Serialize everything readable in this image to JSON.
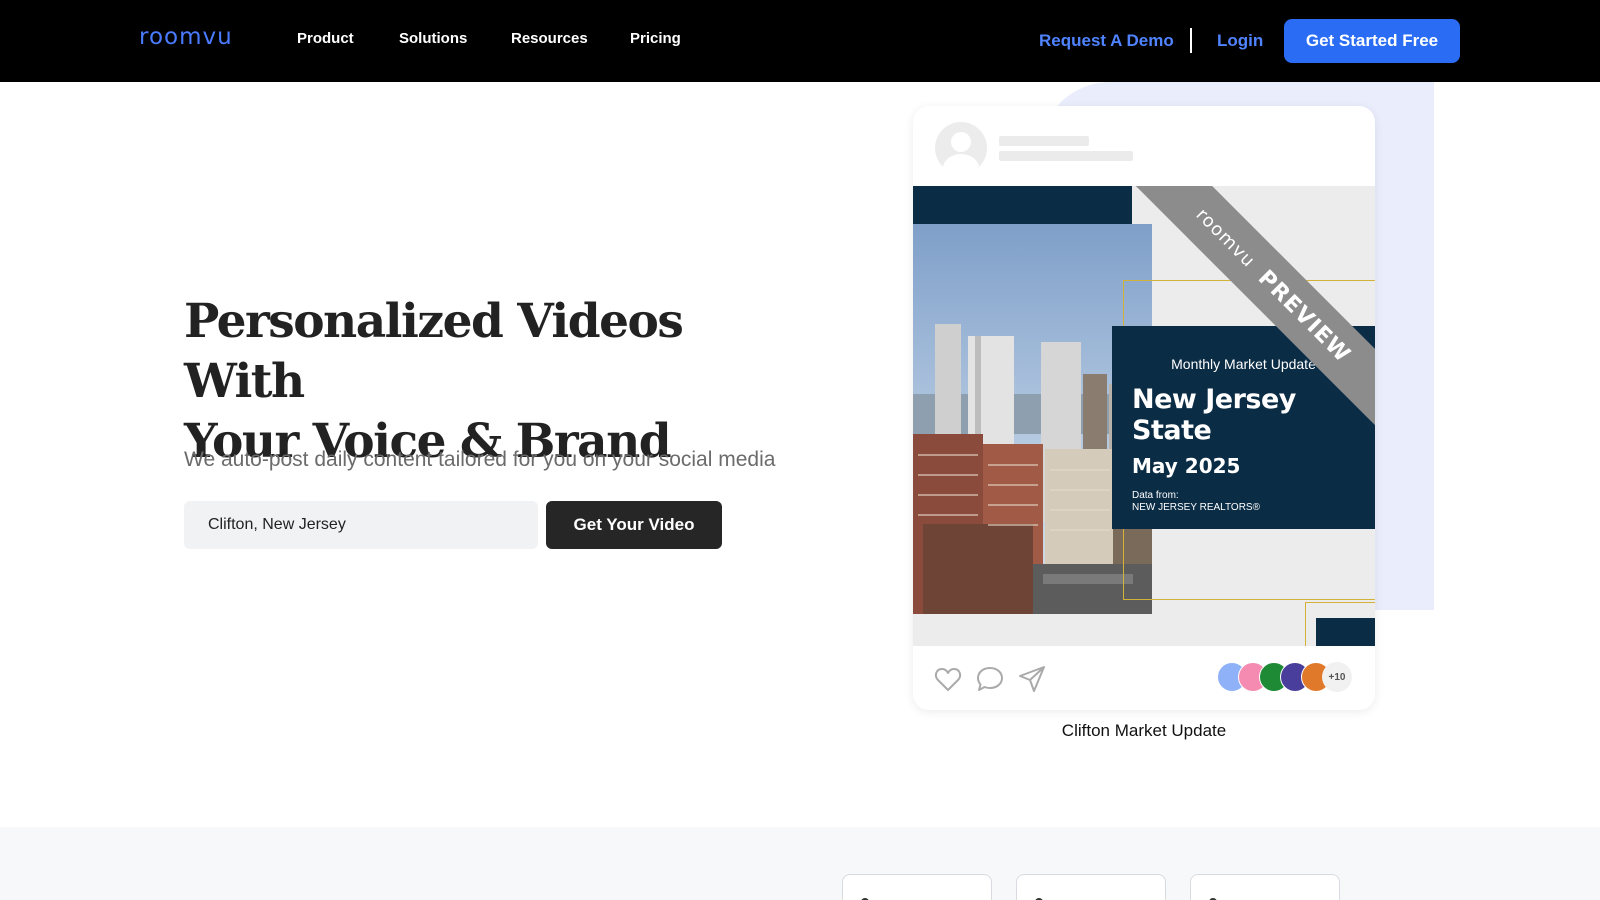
{
  "nav": {
    "logo": "roomvu",
    "items": [
      {
        "label": "Product"
      },
      {
        "label": "Solutions"
      },
      {
        "label": "Resources"
      },
      {
        "label": "Pricing"
      }
    ],
    "request_demo": "Request A Demo",
    "login": "Login",
    "cta": "Get Started Free"
  },
  "hero": {
    "title_line1": "Personalized Videos With",
    "title_line2": "Your Voice & Brand",
    "subtitle": "We auto-post daily content tailored for you on your social media",
    "location_value": "Clifton, New Jersey",
    "button": "Get Your Video"
  },
  "preview": {
    "kicker": "Monthly Market Update",
    "title": "New Jersey State",
    "date": "May 2025",
    "source_label": "Data from:",
    "source": "NEW JERSEY REALTORS®",
    "ribbon_brand": "roomvu",
    "ribbon_text": "PREVIEW",
    "more_count": "+10",
    "caption": "Clifton Market Update",
    "icons": [
      "heart-icon",
      "comment-icon",
      "send-icon"
    ],
    "avatar_colors": [
      "#8fb1f7",
      "#f58bb0",
      "#1e8a35",
      "#4a3e9c",
      "#e07a2a"
    ]
  },
  "colors": {
    "accent": "#2a6df4",
    "link": "#4f83ff",
    "navy": "#0b2c45",
    "gold": "#d4b23a"
  }
}
